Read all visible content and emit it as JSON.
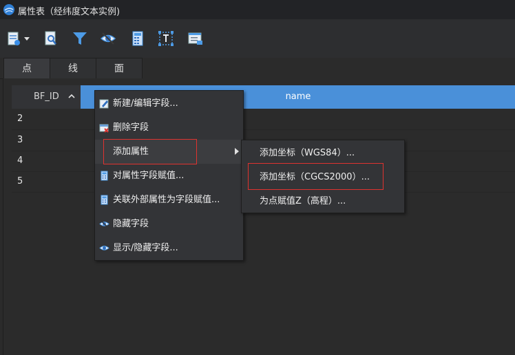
{
  "window": {
    "title": "属性表（经纬度文本实例)"
  },
  "toolbar": {
    "buttons": [
      {
        "icon": "new-table-icon"
      },
      {
        "icon": "dropdown-caret-icon"
      },
      {
        "icon": "find-icon"
      },
      {
        "icon": "filter-icon"
      },
      {
        "icon": "hide-icon"
      },
      {
        "icon": "calculator-icon"
      },
      {
        "icon": "text-icon"
      },
      {
        "icon": "field-list-icon"
      }
    ]
  },
  "tabs": [
    {
      "label": "点",
      "active": true
    },
    {
      "label": "线",
      "active": false
    },
    {
      "label": "面",
      "active": false
    }
  ],
  "grid": {
    "columns": [
      {
        "label": "BF_ID",
        "sort": "ascending"
      },
      {
        "label": "name",
        "selected": true
      }
    ],
    "rows": [
      "2",
      "3",
      "4",
      "5"
    ]
  },
  "context_menu": {
    "items": [
      {
        "label": "新建/编辑字段...",
        "icon": "edit-field-icon"
      },
      {
        "label": "删除字段",
        "icon": "delete-field-icon"
      },
      {
        "label": "添加属性",
        "icon": "",
        "has_submenu": true,
        "highlighted": true
      },
      {
        "label": "对属性字段赋值...",
        "icon": "calculator-icon"
      },
      {
        "label": "关联外部属性为字段赋值...",
        "icon": "calculator-icon"
      },
      {
        "label": "隐藏字段",
        "icon": "hide-eye-icon"
      },
      {
        "label": "显示/隐藏字段...",
        "icon": "show-eye-icon"
      }
    ]
  },
  "submenu": {
    "items": [
      {
        "label": "添加坐标（WGS84）..."
      },
      {
        "label": "添加坐标（CGCS2000）...",
        "highlighted": true
      },
      {
        "label": "为点赋值Z（高程）..."
      }
    ]
  },
  "colors": {
    "accent": "#4a90d9",
    "highlight_border": "#e0322f",
    "background": "#2b2b2b"
  }
}
